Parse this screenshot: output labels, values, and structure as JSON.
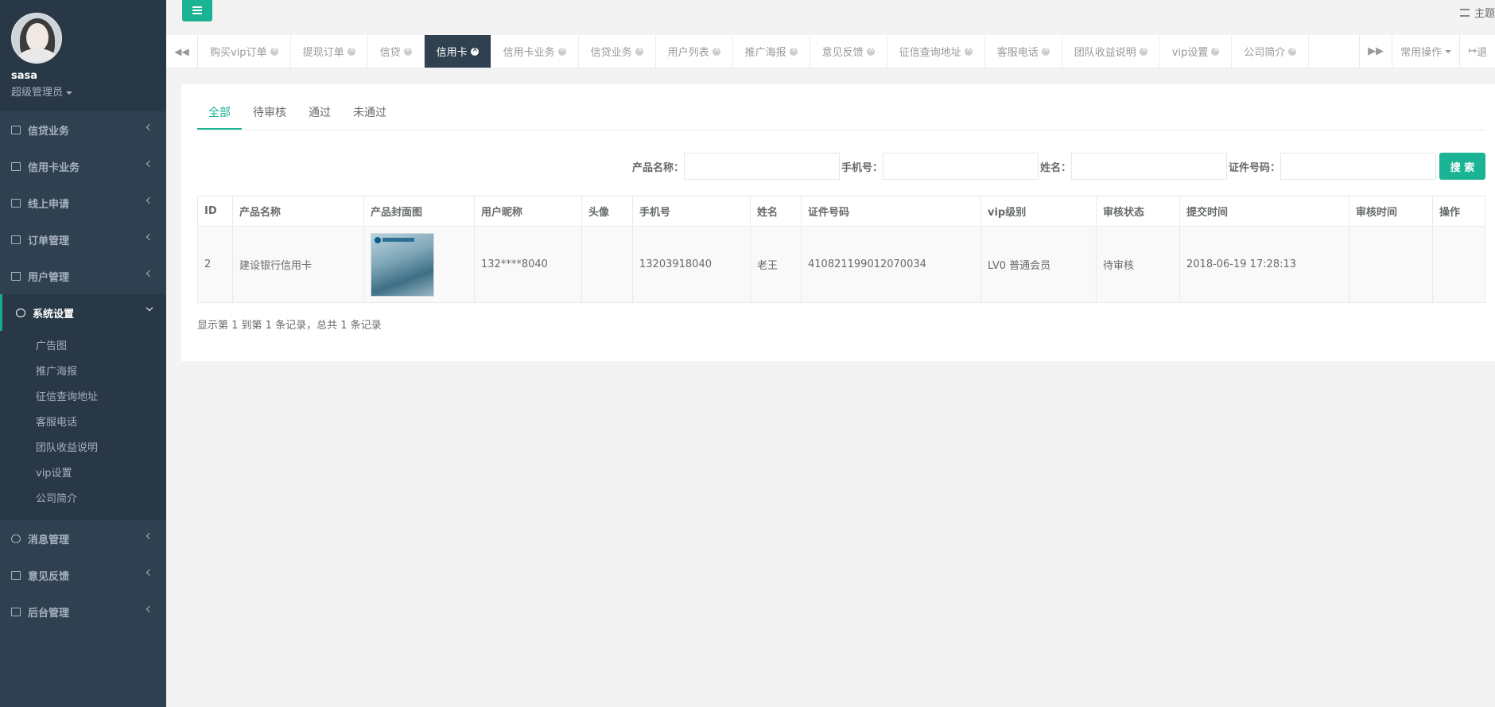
{
  "profile": {
    "name": "sasa",
    "role": "超级管理员"
  },
  "sidebar": {
    "items": [
      {
        "label": "信贷业务",
        "icon": "calendar-icon"
      },
      {
        "label": "信用卡业务",
        "icon": "credit-card-icon"
      },
      {
        "label": "线上申请",
        "icon": "edit-icon"
      },
      {
        "label": "订单管理",
        "icon": "list-icon"
      },
      {
        "label": "用户管理",
        "icon": "user-icon"
      },
      {
        "label": "系统设置",
        "icon": "gears-icon"
      },
      {
        "label": "消息管理",
        "icon": "comment-icon"
      },
      {
        "label": "意见反馈",
        "icon": "tag-icon"
      },
      {
        "label": "后台管理",
        "icon": "desktop-icon"
      }
    ],
    "active_sub": [
      "广告图",
      "推广海报",
      "征信查询地址",
      "客服电话",
      "团队收益说明",
      "vip设置",
      "公司简介"
    ]
  },
  "topbar": {
    "theme_label": "主题"
  },
  "tabs": [
    "购买vip订单",
    "提现订单",
    "信贷",
    "信用卡",
    "信用卡业务",
    "信贷业务",
    "用户列表",
    "推广海报",
    "意见反馈",
    "征信查询地址",
    "客服电话",
    "团队收益说明",
    "vip设置",
    "公司简介"
  ],
  "active_tab": "信用卡",
  "tab_right": {
    "common_ops": "常用操作",
    "exit": "退"
  },
  "subtabs": [
    "全部",
    "待审核",
    "通过",
    "未通过"
  ],
  "search": {
    "product_label": "产品名称：",
    "phone_label": "手机号：",
    "name_label": "姓名：",
    "id_label": "证件号码：",
    "button": "搜 索"
  },
  "table": {
    "headers": [
      "ID",
      "产品名称",
      "产品封面图",
      "用户昵称",
      "头像",
      "手机号",
      "姓名",
      "证件号码",
      "vip级别",
      "审核状态",
      "提交时间",
      "审核时间",
      "操作"
    ],
    "rows": [
      {
        "id": "2",
        "product": "建设银行信用卡",
        "nickname": "132****8040",
        "avatar": "",
        "phone": "13203918040",
        "name": "老王",
        "idno": "410821199012070034",
        "vip": "LV0 普通会员",
        "status": "待审核",
        "submit_time": "2018-06-19 17:28:13",
        "review_time": "",
        "ops": ""
      }
    ]
  },
  "pagination": "显示第 1 到第 1 条记录，总共 1 条记录",
  "colors": {
    "accent": "#1ab394",
    "sidebar": "#2f4050"
  }
}
